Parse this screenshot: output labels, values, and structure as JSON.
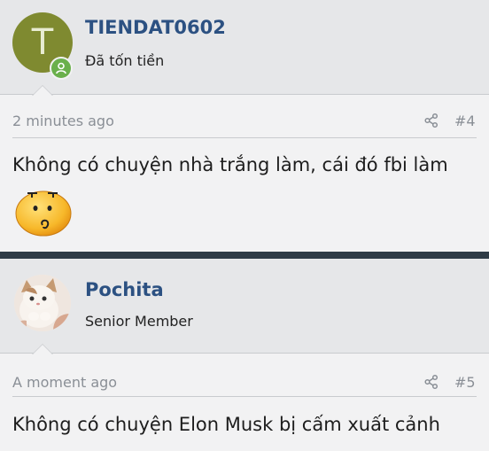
{
  "posts": [
    {
      "user": {
        "name": "TIENDAT0602",
        "title": "Đã tốn tiền",
        "avatar_letter": "T",
        "online": true
      },
      "time": "2 minutes ago",
      "number": "#4",
      "text": "Không có chuyện nhà trắng làm, cái đó fbi làm",
      "emoji": "confused-face"
    },
    {
      "user": {
        "name": "Pochita",
        "title": "Senior Member",
        "avatar": "cat-photo"
      },
      "time": "A moment ago",
      "number": "#5",
      "text": "Không có chuyện Elon Musk bị cấm xuất cảnh"
    }
  ],
  "icons": {
    "share": "share-icon"
  },
  "colors": {
    "username": "#2c5182",
    "divider": "#2f3b46",
    "online": "#6ab04c",
    "avatar_bg": "#7f8a30"
  }
}
